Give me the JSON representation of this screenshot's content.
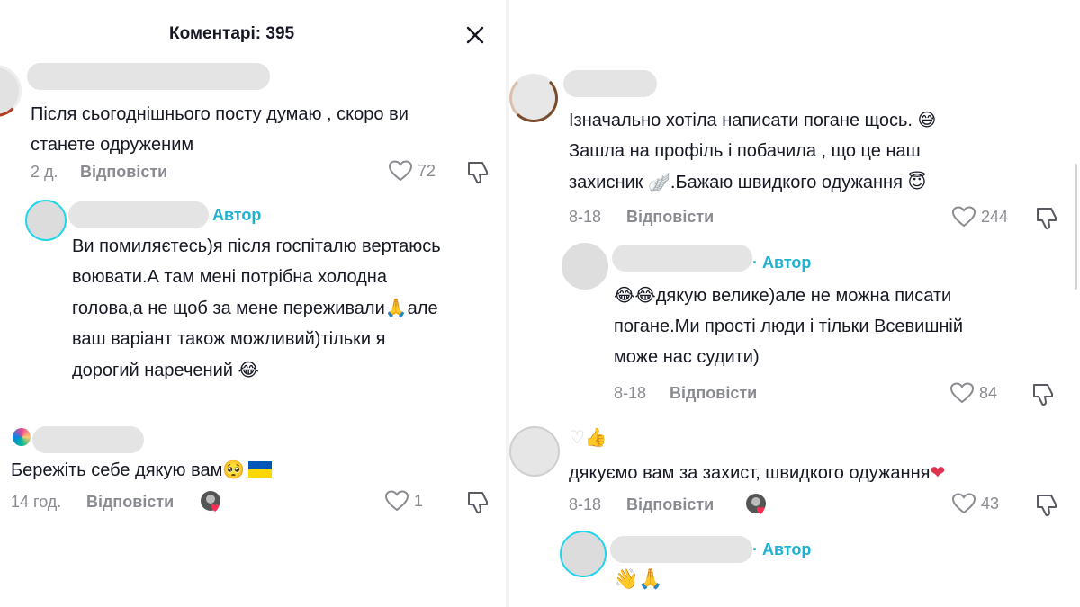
{
  "header": {
    "title": "Коментарі: 395"
  },
  "left": {
    "comments": [
      {
        "text_line1": "Після сьогоднішнього посту думаю , скоро ви",
        "text_line2": "станете одруженим",
        "time": "2 д.",
        "reply_label": "Відповісти",
        "likes": "72"
      },
      {
        "badge": "Автор",
        "line1": "Ви помиляєтесь)я після госпіталю вертаюсь",
        "line2": "воювати.А там мені потрібна холодна",
        "line3": "голова,а не щоб за мене переживали",
        "line3_tail": "але",
        "line4": "ваш варіант також можливий)тільки я",
        "line5": "дорогий наречений"
      },
      {
        "text": "Бережіть себе дякую вам",
        "time": "14 год.",
        "reply_label": "Відповісти",
        "likes": "1"
      }
    ]
  },
  "right": {
    "comments": [
      {
        "line1": "Ізначально хотіла написати погане щось.",
        "line2": "Зашла на профіль і побачила , що це наш",
        "line3": "захисник",
        "line3_tail": ".Бажаю швидкого одужання",
        "time": "8-18",
        "reply_label": "Відповісти",
        "likes": "244"
      },
      {
        "badge": "· Автор",
        "line1": "дякую велике)але не можна писати",
        "line2": "погане.Ми прості люди і тільки Всевишній",
        "line3": "може нас судити)",
        "time": "8-18",
        "reply_label": "Відповісти",
        "likes": "84"
      },
      {
        "text": "дякуємо вам за захист, швидкого одужання",
        "time": "8-18",
        "reply_label": "Відповісти",
        "likes": "43"
      },
      {
        "badge": "· Автор"
      }
    ]
  },
  "colors": {
    "accent": "#20b2d1",
    "muted": "#8a8b91",
    "ring": "#20d5ec"
  }
}
